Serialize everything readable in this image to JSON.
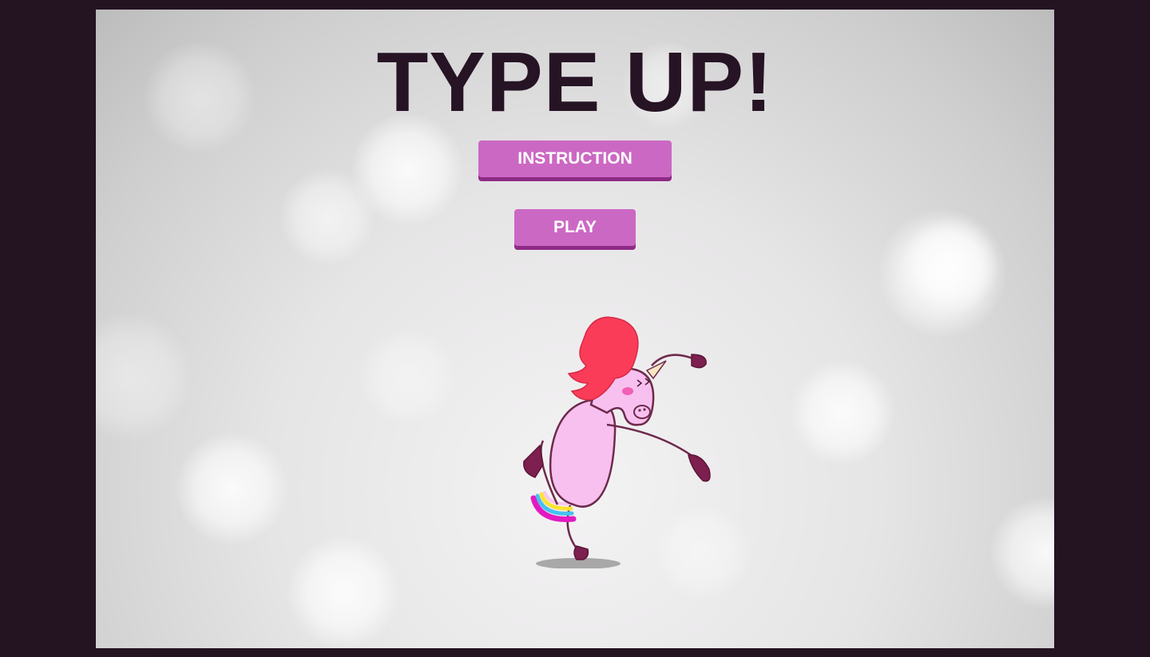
{
  "game": {
    "title": "TYPE UP!",
    "buttons": {
      "instruction_label": "INSTRUCTION",
      "play_label": "PLAY"
    },
    "mascot": "dancing-unicorn-illustration"
  },
  "colors": {
    "page_background": "#241422",
    "title": "#261424",
    "button_fill": "#cb68c3",
    "button_shadow": "#8e2a86",
    "button_text": "#ffffff",
    "unicorn_body": "#f7c0ef",
    "unicorn_mane": "#fb3c58",
    "unicorn_hooves": "#7d1f4f"
  }
}
